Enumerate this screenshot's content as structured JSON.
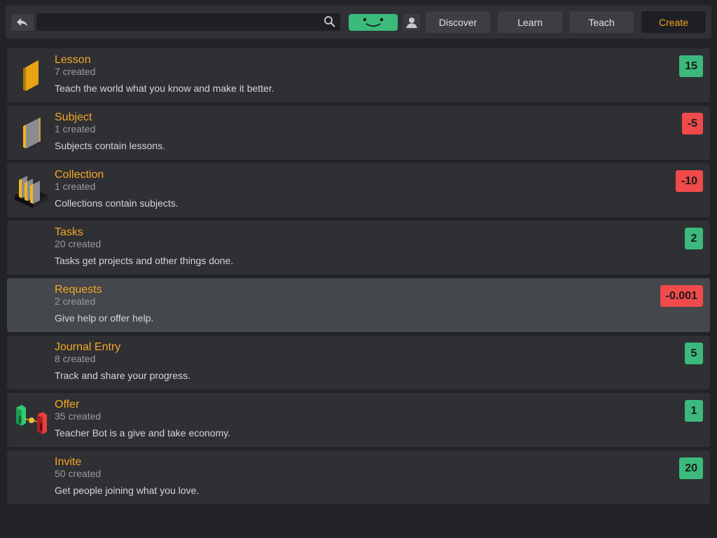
{
  "colors": {
    "accent": "#f5a623",
    "positive": "#3cba7c",
    "negative": "#f04a4a",
    "background": "#222326",
    "card": "#2f3034"
  },
  "header": {
    "search_placeholder": "",
    "nav": {
      "discover": "Discover",
      "learn": "Learn",
      "teach": "Teach",
      "create": "Create"
    }
  },
  "items": [
    {
      "title": "Lesson",
      "count": "7 created",
      "desc": "Teach the world what you know and make it better.",
      "score": "15",
      "icon": "book-icon"
    },
    {
      "title": "Subject",
      "count": "1 created",
      "desc": "Subjects contain lessons.",
      "score": "-5",
      "icon": "binder-icon"
    },
    {
      "title": "Collection",
      "count": "1 created",
      "desc": "Collections contain subjects.",
      "score": "-10",
      "icon": "bookshelf-icon"
    },
    {
      "title": "Tasks",
      "count": "20 created",
      "desc": "Tasks get projects and other things done.",
      "score": "2",
      "icon": ""
    },
    {
      "title": "Requests",
      "count": "2 created",
      "desc": "Give help or offer help.",
      "score": "-0.001",
      "icon": ""
    },
    {
      "title": "Journal Entry",
      "count": "8 created",
      "desc": "Track and share your progress.",
      "score": "5",
      "icon": ""
    },
    {
      "title": "Offer",
      "count": "35 created",
      "desc": "Teacher Bot is a give and take economy.",
      "score": "1",
      "icon": "exchange-icon"
    },
    {
      "title": "Invite",
      "count": "50 created",
      "desc": "Get people joining what you love.",
      "score": "20",
      "icon": ""
    }
  ]
}
